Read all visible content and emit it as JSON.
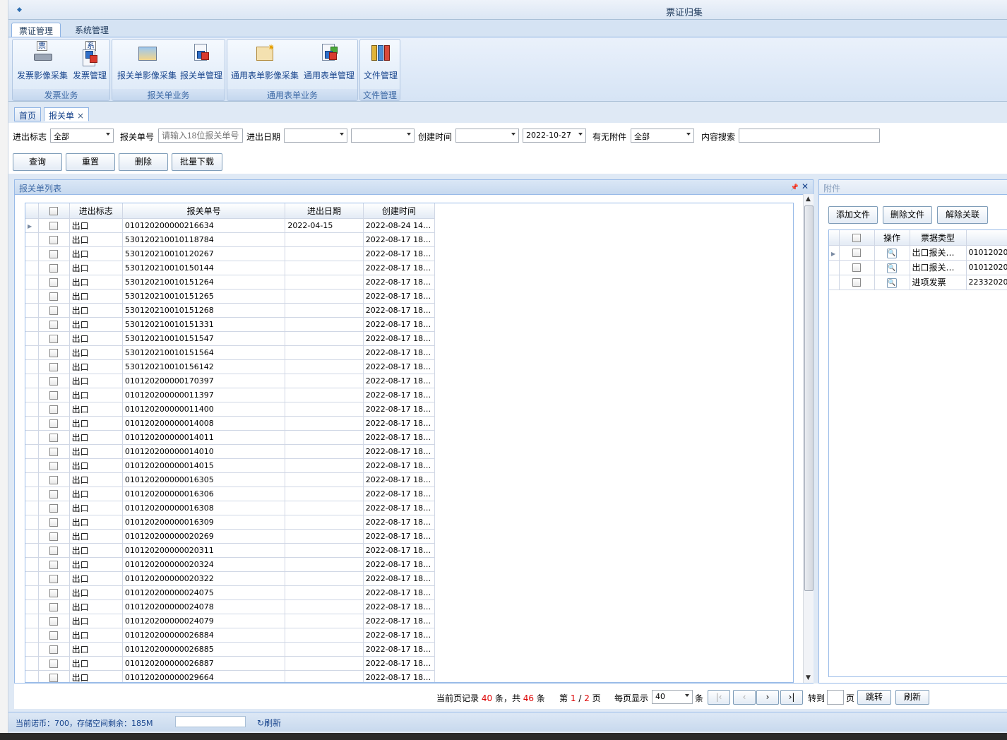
{
  "window": {
    "title": "票证归集"
  },
  "ribbon": {
    "tabs": [
      "票证管理",
      "系统管理"
    ],
    "groups": [
      {
        "label": "发票业务",
        "buttons": [
          "发票影像采集",
          "发票管理"
        ]
      },
      {
        "label": "报关单业务",
        "buttons": [
          "报关单影像采集",
          "报关单管理"
        ]
      },
      {
        "label": "通用表单业务",
        "buttons": [
          "通用表单影像采集",
          "通用表单管理"
        ]
      },
      {
        "label": "文件管理",
        "buttons": [
          "文件管理"
        ]
      }
    ],
    "icon_badges": [
      "票",
      "系"
    ]
  },
  "doc_tabs": {
    "home": "首页",
    "current": "报关单",
    "close": "×"
  },
  "filters": {
    "direction_label": "进出标志",
    "direction_value": "全部",
    "decl_no_label": "报关单号",
    "decl_no_placeholder": "请输入18位报关单号",
    "io_date_label": "进出日期",
    "io_date_from": "",
    "io_date_to": "",
    "create_time_label": "创建时间",
    "create_time_from": "",
    "create_time_to": "2022-10-27",
    "attach_label": "有无附件",
    "attach_value": "全部",
    "content_label": "内容搜索",
    "content_value": "",
    "buttons": {
      "query": "查询",
      "reset": "重置",
      "delete": "删除",
      "batch_download": "批量下载"
    }
  },
  "main_panel": {
    "title": "报关单列表",
    "pin": "📌",
    "close": "✕",
    "columns": [
      "进出标志",
      "报关单号",
      "进出日期",
      "创建时间"
    ],
    "rows": [
      [
        "出口",
        "010120200000216634",
        "2022-04-15",
        "2022-08-24 14…"
      ],
      [
        "出口",
        "530120210010118784",
        "",
        "2022-08-17 18…"
      ],
      [
        "出口",
        "530120210010120267",
        "",
        "2022-08-17 18…"
      ],
      [
        "出口",
        "530120210010150144",
        "",
        "2022-08-17 18…"
      ],
      [
        "出口",
        "530120210010151264",
        "",
        "2022-08-17 18…"
      ],
      [
        "出口",
        "530120210010151265",
        "",
        "2022-08-17 18…"
      ],
      [
        "出口",
        "530120210010151268",
        "",
        "2022-08-17 18…"
      ],
      [
        "出口",
        "530120210010151331",
        "",
        "2022-08-17 18…"
      ],
      [
        "出口",
        "530120210010151547",
        "",
        "2022-08-17 18…"
      ],
      [
        "出口",
        "530120210010151564",
        "",
        "2022-08-17 18…"
      ],
      [
        "出口",
        "530120210010156142",
        "",
        "2022-08-17 18…"
      ],
      [
        "出口",
        "010120200000170397",
        "",
        "2022-08-17 18…"
      ],
      [
        "出口",
        "010120200000011397",
        "",
        "2022-08-17 18…"
      ],
      [
        "出口",
        "010120200000011400",
        "",
        "2022-08-17 18…"
      ],
      [
        "出口",
        "010120200000014008",
        "",
        "2022-08-17 18…"
      ],
      [
        "出口",
        "010120200000014011",
        "",
        "2022-08-17 18…"
      ],
      [
        "出口",
        "010120200000014010",
        "",
        "2022-08-17 18…"
      ],
      [
        "出口",
        "010120200000014015",
        "",
        "2022-08-17 18…"
      ],
      [
        "出口",
        "010120200000016305",
        "",
        "2022-08-17 18…"
      ],
      [
        "出口",
        "010120200000016306",
        "",
        "2022-08-17 18…"
      ],
      [
        "出口",
        "010120200000016308",
        "",
        "2022-08-17 18…"
      ],
      [
        "出口",
        "010120200000016309",
        "",
        "2022-08-17 18…"
      ],
      [
        "出口",
        "010120200000020269",
        "",
        "2022-08-17 18…"
      ],
      [
        "出口",
        "010120200000020311",
        "",
        "2022-08-17 18…"
      ],
      [
        "出口",
        "010120200000020324",
        "",
        "2022-08-17 18…"
      ],
      [
        "出口",
        "010120200000020322",
        "",
        "2022-08-17 18…"
      ],
      [
        "出口",
        "010120200000024075",
        "",
        "2022-08-17 18…"
      ],
      [
        "出口",
        "010120200000024078",
        "",
        "2022-08-17 18…"
      ],
      [
        "出口",
        "010120200000024079",
        "",
        "2022-08-17 18…"
      ],
      [
        "出口",
        "010120200000026884",
        "",
        "2022-08-17 18…"
      ],
      [
        "出口",
        "010120200000026885",
        "",
        "2022-08-17 18…"
      ],
      [
        "出口",
        "010120200000026887",
        "",
        "2022-08-17 18…"
      ],
      [
        "出口",
        "010120200000029664",
        "",
        "2022-08-17 18…"
      ]
    ]
  },
  "pager": {
    "t1": "当前页记录",
    "page_count": "40",
    "t2": "条，共",
    "total": "46",
    "t3": "条",
    "t4": "第",
    "page": "1",
    "slash": "/",
    "pages": "2",
    "t5": "页",
    "t6": "每页显示",
    "page_size": "40",
    "t7": "条",
    "first": "|‹",
    "prev": "‹",
    "next": "›",
    "last": "›|",
    "goto_label": "转到",
    "goto_value": "",
    "t8": "页",
    "jump": "跳转",
    "refresh": "刷新"
  },
  "attachment": {
    "title": "附件",
    "buttons": {
      "add": "添加文件",
      "remove": "删除文件",
      "unlink": "解除关联"
    },
    "columns": [
      "操作",
      "票据类型"
    ],
    "rows": [
      [
        "出口报关…",
        "010120200"
      ],
      [
        "出口报关…",
        "010120200"
      ],
      [
        "进项发票",
        "223320200"
      ]
    ]
  },
  "status": {
    "text": "当前诺币：700，存储空间剩余：185M",
    "refresh": "刷新"
  },
  "colors": {
    "accent": "#15428b",
    "border": "#99bbe8",
    "red": "#dd0000"
  }
}
